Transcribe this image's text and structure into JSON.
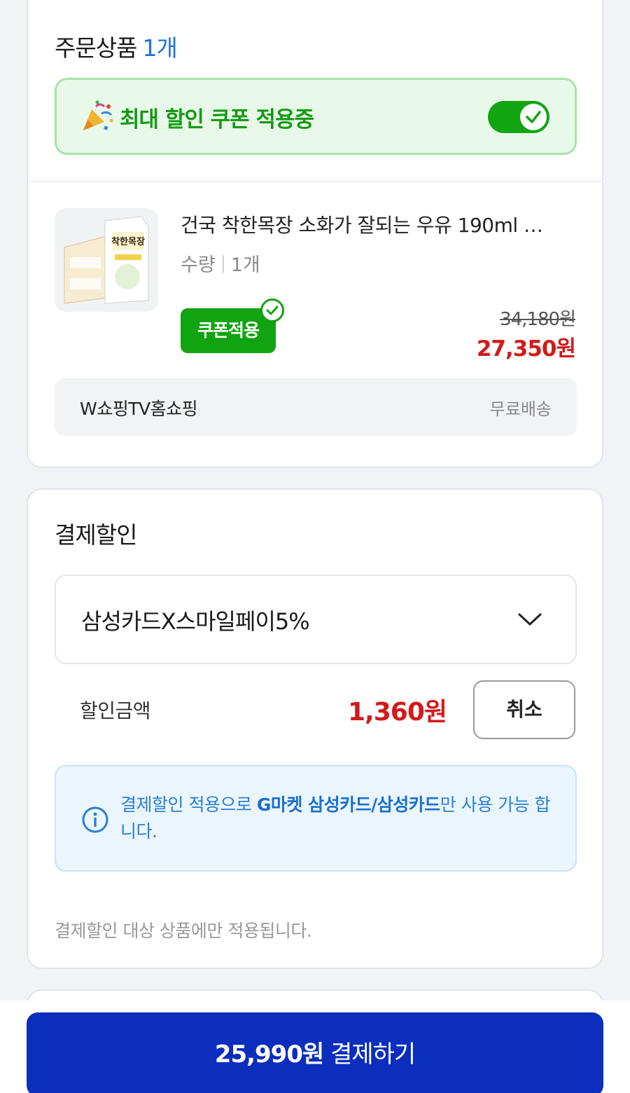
{
  "order_section": {
    "title": "주문상품",
    "count": "1개",
    "coupon_banner": {
      "text": "최대 할인 쿠폰 적용중",
      "toggle_on": true
    },
    "product": {
      "name": "건국 착한목장 소화가 잘되는 우유 190ml …",
      "qty_label": "수량",
      "qty_value": "1개",
      "coupon_badge": "쿠폰적용",
      "original_price": "34,180원",
      "sale_price": "27,350원",
      "thumb_brand": "착한목장"
    },
    "seller": {
      "name": "W쇼핑TV홈쇼핑",
      "shipping": "무료배송"
    }
  },
  "payment_discount": {
    "title": "결제할인",
    "selected_option": "삼성카드X스마일페이5%",
    "discount_label": "할인금액",
    "discount_amount": "1,360원",
    "cancel_label": "취소",
    "info": {
      "pre": "결제할인 적용으로 ",
      "bold": "G마켓 삼성카드/삼성카드",
      "post": "만 사용 가능 합니다."
    },
    "note": "결제할인 대상 상품에만 적용됩니다."
  },
  "checkout": {
    "amount": "25,990원",
    "label": "결제하기"
  },
  "colors": {
    "accent_blue": "#1a73d9",
    "coupon_green": "#12a312",
    "price_red": "#d21a1a",
    "pay_button": "#0b2ebd"
  }
}
